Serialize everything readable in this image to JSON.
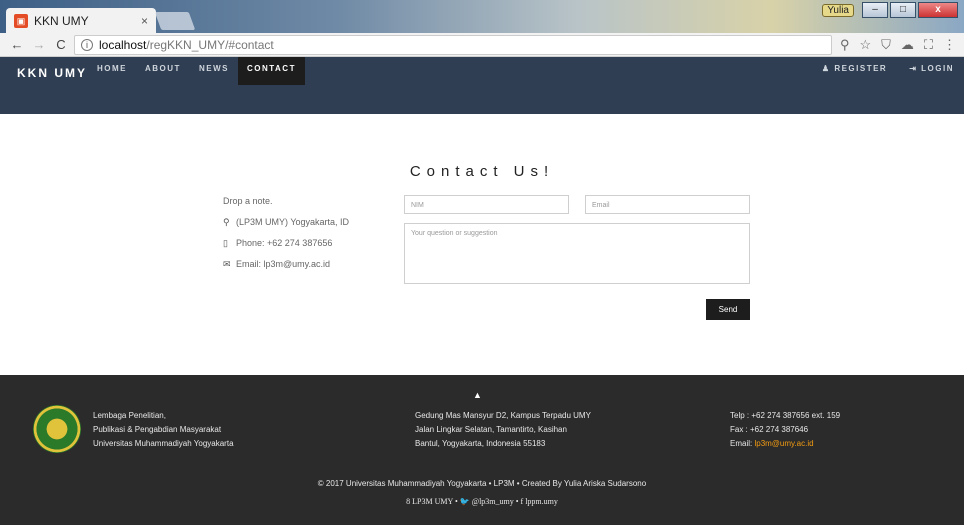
{
  "browser": {
    "tab_title": "KKN UMY",
    "tab_close": "×",
    "user_badge": "Yulia",
    "url_host": "localhost",
    "url_path": "/regKKN_UMY/#contact"
  },
  "navbar": {
    "brand": "KKN UMY",
    "links": [
      "HOME",
      "ABOUT",
      "NEWS",
      "CONTACT"
    ],
    "register": "REGISTER",
    "login": "LOGIN"
  },
  "contact": {
    "heading": "Contact Us!",
    "drop_note": "Drop a note.",
    "location": "(LP3M UMY) Yogyakarta, ID",
    "phone": "Phone: +62 274 387656",
    "email": "Email: lp3m@umy.ac.id",
    "nim_placeholder": "NIM",
    "email_placeholder": "Email",
    "message_placeholder": "Your question or suggestion",
    "send_label": "Send"
  },
  "footer": {
    "org_lines": [
      "Lembaga Penelitian,",
      "Publikasi & Pengabdian Masyarakat",
      "Universitas Muhammadiyah Yogyakarta"
    ],
    "address_lines": [
      "Gedung Mas Mansyur D2, Kampus Terpadu UMY",
      "Jalan Lingkar Selatan, Tamantirto, Kasihan",
      "Bantul, Yogyakarta, Indonesia 55183"
    ],
    "telp": "Telp   : +62 274 387656 ext. 159",
    "fax": "Fax    : +62 274 387646",
    "email_label": "Email:",
    "email_value": "lp3m@umy.ac.id",
    "copyright": "© 2017 Universitas Muhammadiyah Yogyakarta • LP3M • Created By Yulia Ariska Sudarsono",
    "social": "8 LP3M UMY • 🐦 @lp3m_umy • f lppm.umy"
  },
  "colors": {
    "navbar": "#2f3e52",
    "footer": "#2b2b2b",
    "accent": "#f39c12"
  }
}
